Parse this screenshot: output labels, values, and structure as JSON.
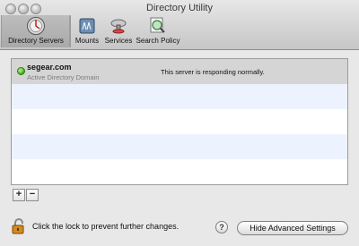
{
  "window": {
    "title": "Directory Utility"
  },
  "toolbar": {
    "items": [
      {
        "label": "Directory Servers",
        "icon": "directory-servers-icon",
        "selected": true
      },
      {
        "label": "Mounts",
        "icon": "mounts-icon"
      },
      {
        "label": "Services",
        "icon": "services-icon"
      },
      {
        "label": "Search Policy",
        "icon": "search-policy-icon"
      }
    ]
  },
  "servers": [
    {
      "name": "segear.com",
      "type": "Active Directory Domain",
      "status": "This server is responding normally.",
      "status_color": "#3aa315"
    }
  ],
  "list_controls": {
    "add_label": "+",
    "remove_label": "−"
  },
  "footer": {
    "lock_text": "Click the lock to prevent further changes.",
    "help_label": "?",
    "advanced_button": "Hide Advanced Settings"
  }
}
